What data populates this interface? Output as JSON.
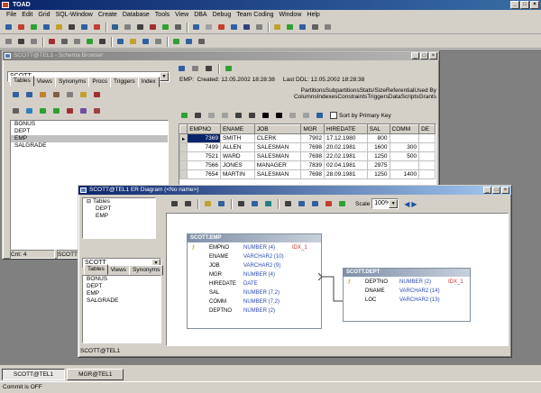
{
  "app": {
    "title": "TOAD"
  },
  "menu": [
    "File",
    "Edit",
    "Grid",
    "SQL-Window",
    "Create",
    "Database",
    "Tools",
    "View",
    "DBA",
    "Debug",
    "Team Coding",
    "Window",
    "Help"
  ],
  "schema_browser": {
    "title": "SCOTT@TEL1 - Schema Browser",
    "schema": "SCOTT",
    "tabs": [
      "Tables",
      "Views",
      "Synonyms",
      "Procs",
      "Triggers",
      "Index"
    ],
    "tables": [
      "BONUS",
      "DEPT",
      "EMP",
      "SALGRADE"
    ],
    "selected_table": "EMP",
    "count_label": "Cnt: 4",
    "status_value": "SCOTT@",
    "info": "EMP:  Created: 12.05.2002 18:28:38     Last DDL: 12.05.2002 18:28:38",
    "detail_tabs_row1": [
      "Partitions",
      "Subpartitions",
      "Stats/Size",
      "Referential",
      "Used By"
    ],
    "detail_tabs_row2": [
      "Columns",
      "Indexes",
      "Constraints",
      "Triggers",
      "Data",
      "Scripts",
      "Grants"
    ],
    "sort_label": "Sort by Primary Key",
    "grid": {
      "headers": [
        "EMPNO",
        "ENAME",
        "JOB",
        "MGR",
        "HIREDATE",
        "SAL",
        "COMM",
        "DE"
      ],
      "rows": [
        [
          "7369",
          "SMITH",
          "CLERK",
          "7902",
          "17.12.1980",
          "800",
          ""
        ],
        [
          "7499",
          "ALLEN",
          "SALESMAN",
          "7698",
          "20.02.1981",
          "1600",
          "300"
        ],
        [
          "7521",
          "WARD",
          "SALESMAN",
          "7698",
          "22.02.1981",
          "1250",
          "500"
        ],
        [
          "7566",
          "JONES",
          "MANAGER",
          "7839",
          "02.04.1981",
          "2975",
          ""
        ],
        [
          "7654",
          "MARTIN",
          "SALESMAN",
          "7698",
          "28.09.1981",
          "1250",
          "1400"
        ]
      ]
    }
  },
  "er_diagram": {
    "title": "SCOTT@TEL1 ER Diagram (<No name>)",
    "tree_root": "Tables",
    "tree_items": [
      "DEPT",
      "EMP"
    ],
    "schema": "SCOTT",
    "tabs": [
      "Tables",
      "Views",
      "Synonyms"
    ],
    "list": [
      "BONUS",
      "DEPT",
      "EMP",
      "SALGRADE"
    ],
    "scale_label": "Scale",
    "scale_value": "100%",
    "status": "SCOTT@TEL1",
    "emp_table": {
      "name": "SCOTT.EMP",
      "index_label": "IDX_1",
      "columns": [
        [
          "EMPNO",
          "NUMBER (4)"
        ],
        [
          "ENAME",
          "VARCHAR2 (10)"
        ],
        [
          "JOB",
          "VARCHAR2 (9)"
        ],
        [
          "MGR",
          "NUMBER (4)"
        ],
        [
          "HIREDATE",
          "DATE"
        ],
        [
          "SAL",
          "NUMBER (7,2)"
        ],
        [
          "COMM",
          "NUMBER (7,2)"
        ],
        [
          "DEPTNO",
          "NUMBER (2)"
        ]
      ]
    },
    "dept_table": {
      "name": "SCOTT.DEPT",
      "index_label": "IDX_1",
      "columns": [
        [
          "DEPTNO",
          "NUMBER (2)"
        ],
        [
          "DNAME",
          "VARCHAR2 (14)"
        ],
        [
          "LOC",
          "VARCHAR2 (13)"
        ]
      ]
    }
  },
  "taskbar": [
    "SCOTT@TEL1",
    "MGR@TEL1"
  ],
  "status": "Commit is OFF"
}
